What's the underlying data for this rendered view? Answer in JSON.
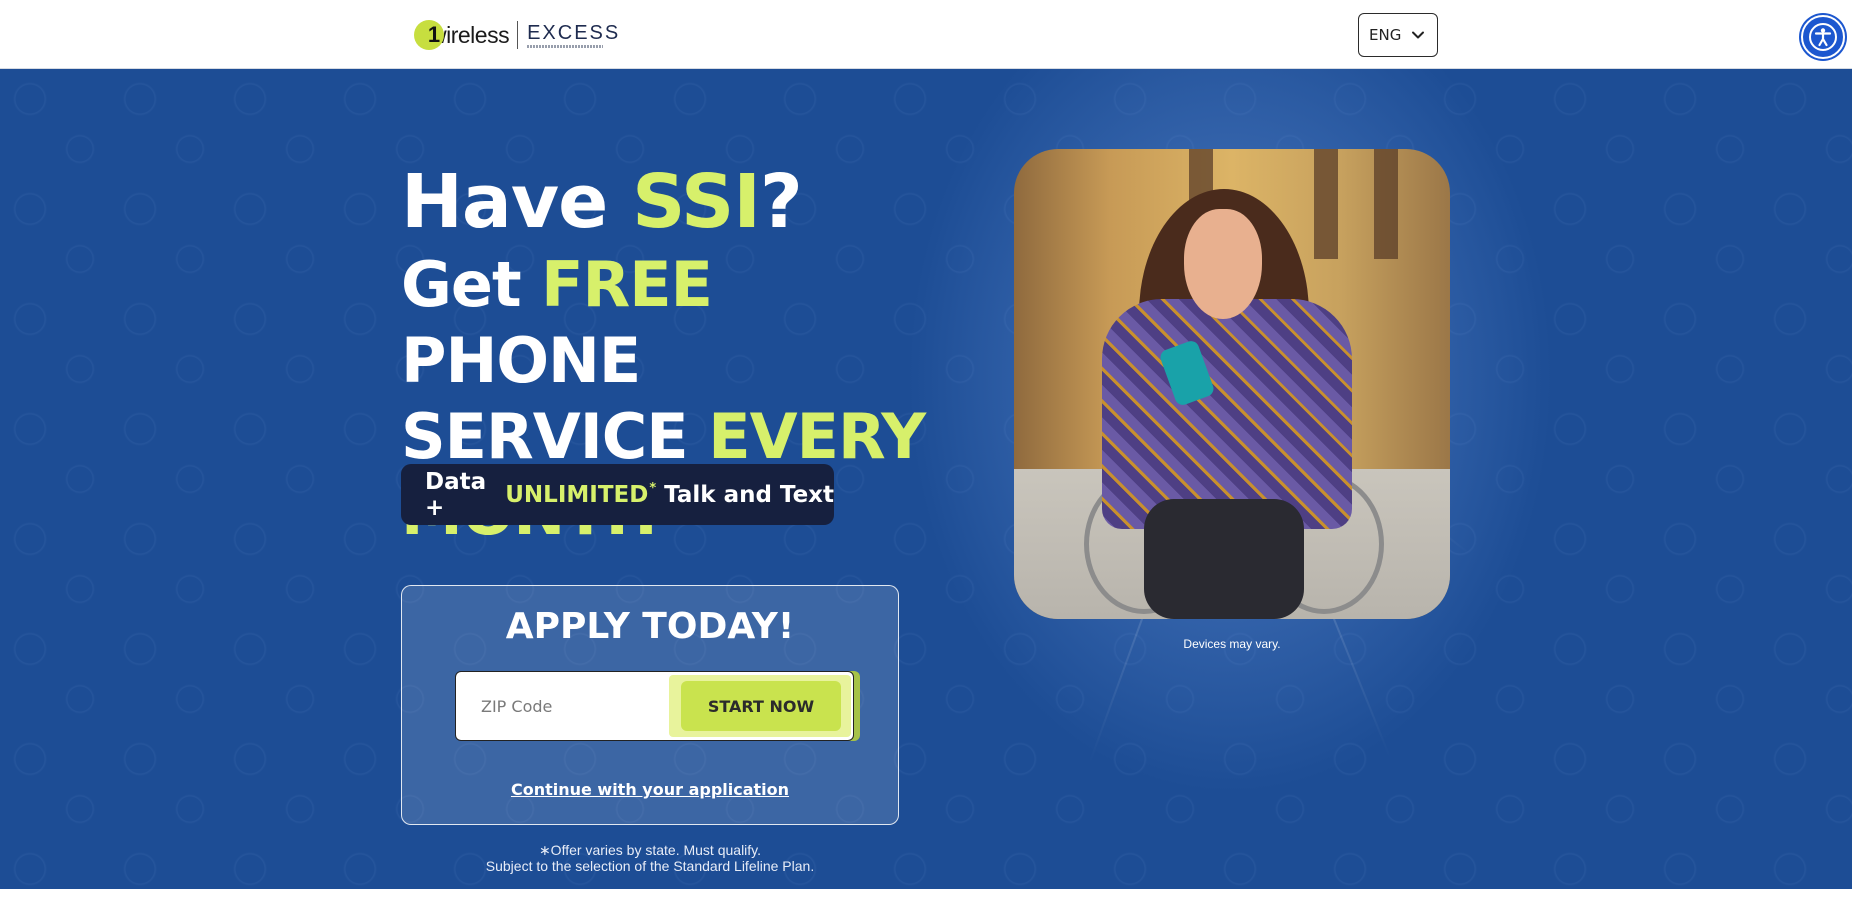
{
  "header": {
    "brand_one": "1",
    "brand_name": "wireless",
    "partner_name": "EXCESS",
    "language": "ENG",
    "accessibility_label": "Accessibility"
  },
  "hero": {
    "headline_have": "Have ",
    "headline_ssi": "SSI",
    "headline_q": "?",
    "get": "Get ",
    "free": "FREE",
    "phone": " PHONE",
    "service": "SERVICE ",
    "every": "EVERY",
    "month": "MONTH",
    "pill_data": "Data + ",
    "pill_unlimited": "UNLIMITED",
    "pill_asterisk": "*",
    "pill_rest": " Talk and Text"
  },
  "apply": {
    "title": "APPLY TODAY!",
    "zip_placeholder": "ZIP Code",
    "start_label": "START NOW",
    "continue_label": "Continue with your application"
  },
  "fineprint": {
    "line1": "∗Offer varies by state. Must qualify.",
    "line2": "Subject to the selection of the Standard Lifeline Plan."
  },
  "image": {
    "caption": "Devices may vary."
  },
  "colors": {
    "hero_bg": "#1d4d95",
    "accent": "#d7f06b",
    "button": "#c9e34e",
    "pill_bg": "#16203f"
  },
  "icons": [
    "chevron-down-icon",
    "accessibility-icon"
  ]
}
